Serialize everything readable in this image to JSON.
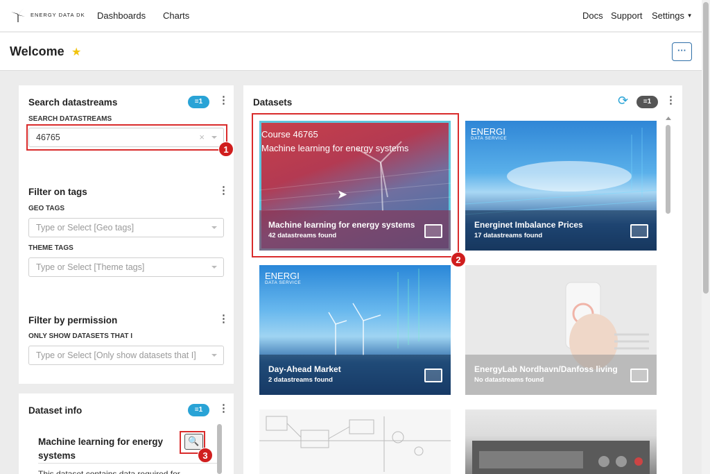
{
  "nav": {
    "brand": "ENERGY DATA DK",
    "links": [
      "Dashboards",
      "Charts"
    ],
    "right_links": [
      "Docs",
      "Support",
      "Settings"
    ]
  },
  "header": {
    "title": "Welcome",
    "more_label": "···"
  },
  "search_panel": {
    "title": "Search datastreams",
    "badge": "1",
    "field_label": "SEARCH DATASTREAMS",
    "value": "46765"
  },
  "tags_panel": {
    "title": "Filter on tags",
    "geo_label": "GEO TAGS",
    "geo_placeholder": "Type or Select [Geo tags]",
    "theme_label": "THEME TAGS",
    "theme_placeholder": "Type or Select [Theme tags]"
  },
  "permission_panel": {
    "title": "Filter by permission",
    "field_label": "ONLY SHOW DATASETS THAT I",
    "placeholder": "Type or Select [Only show datasets that I]"
  },
  "info_panel": {
    "title": "Dataset info",
    "badge": "1",
    "dataset_title": "Machine learning for energy systems",
    "description": "This dataset contains data required for"
  },
  "datasets": {
    "title": "Datasets",
    "badge": "1",
    "tiles": [
      {
        "name": "Machine learning for energy systems",
        "count": "42 datastreams found",
        "overlay_line1": "Course 46765",
        "overlay_line2": "Machine learning for energy systems"
      },
      {
        "name": "Energinet Imbalance Prices",
        "count": "17 datastreams found",
        "logo": "ENERGI",
        "logo_sub": "DATA SERVICE"
      },
      {
        "name": "Day-Ahead Market",
        "count": "2 datastreams found",
        "logo": "ENERGI",
        "logo_sub": "DATA SERVICE"
      },
      {
        "name": "EnergyLab Nordhavn/Danfoss living",
        "count": "No datastreams found"
      }
    ]
  },
  "markers": [
    "1",
    "2",
    "3"
  ],
  "colors": {
    "accent": "#29a3d6",
    "highlight": "#d92b2b",
    "star": "#f1c40f"
  }
}
